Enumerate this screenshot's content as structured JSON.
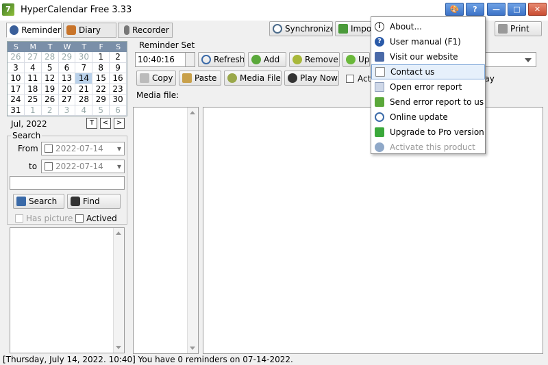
{
  "window": {
    "title": "HyperCalendar Free 3.33",
    "app_icon": "7"
  },
  "titlebar_buttons": {
    "theme": "🎨",
    "help": "?",
    "minimize": "—",
    "maximize": "□",
    "close": "✕"
  },
  "tabs": [
    {
      "label": "Reminder",
      "active": true
    },
    {
      "label": "Diary",
      "active": false
    },
    {
      "label": "Recorder",
      "active": false
    }
  ],
  "toolbar": {
    "synchronize": "Synchronize",
    "import": "Impo",
    "print": "Print"
  },
  "calendar": {
    "weekdays": [
      "S",
      "M",
      "T",
      "W",
      "T",
      "F",
      "S"
    ],
    "days": [
      {
        "d": "26",
        "o": true
      },
      {
        "d": "27",
        "o": true
      },
      {
        "d": "28",
        "o": true
      },
      {
        "d": "29",
        "o": true
      },
      {
        "d": "30",
        "o": true
      },
      {
        "d": "1",
        "o": false
      },
      {
        "d": "2",
        "o": false
      },
      {
        "d": "3",
        "o": false
      },
      {
        "d": "4",
        "o": false
      },
      {
        "d": "5",
        "o": false
      },
      {
        "d": "6",
        "o": false
      },
      {
        "d": "7",
        "o": false
      },
      {
        "d": "8",
        "o": false
      },
      {
        "d": "9",
        "o": false
      },
      {
        "d": "10",
        "o": false
      },
      {
        "d": "11",
        "o": false
      },
      {
        "d": "12",
        "o": false
      },
      {
        "d": "13",
        "o": false
      },
      {
        "d": "14",
        "o": false,
        "t": true
      },
      {
        "d": "15",
        "o": false
      },
      {
        "d": "16",
        "o": false
      },
      {
        "d": "17",
        "o": false
      },
      {
        "d": "18",
        "o": false
      },
      {
        "d": "19",
        "o": false
      },
      {
        "d": "20",
        "o": false
      },
      {
        "d": "21",
        "o": false
      },
      {
        "d": "22",
        "o": false
      },
      {
        "d": "23",
        "o": false
      },
      {
        "d": "24",
        "o": false
      },
      {
        "d": "25",
        "o": false
      },
      {
        "d": "26",
        "o": false
      },
      {
        "d": "27",
        "o": false
      },
      {
        "d": "28",
        "o": false
      },
      {
        "d": "29",
        "o": false
      },
      {
        "d": "30",
        "o": false
      },
      {
        "d": "31",
        "o": false
      },
      {
        "d": "1",
        "o": true
      },
      {
        "d": "2",
        "o": true
      },
      {
        "d": "3",
        "o": true
      },
      {
        "d": "4",
        "o": true
      },
      {
        "d": "5",
        "o": true
      },
      {
        "d": "6",
        "o": true
      }
    ],
    "month_label": "Jul, 2022",
    "nav_today": "T",
    "nav_prev": "<",
    "nav_next": ">"
  },
  "search": {
    "group_label": "Search",
    "from_label": "From",
    "from_value": "2022-07-14",
    "to_label": "to",
    "to_value": "2022-07-14",
    "text_value": "",
    "search_button": "Search",
    "find_button": "Find",
    "has_picture_label": "Has picture",
    "actived_label": "Actived"
  },
  "reminder_set": {
    "group_label": "Reminder Set",
    "time_value": "10:40:16",
    "refresh": "Refresh",
    "add": "Add",
    "remove": "Remove",
    "update": "Up",
    "copy": "Copy",
    "paste": "Paste",
    "media_file_button": "Media File",
    "play_now": "Play Now",
    "active_label": "Act",
    "play_label": "lay",
    "media_file_label": "Media file:"
  },
  "menu": {
    "items": [
      {
        "label": "About...",
        "icon": "info-icon",
        "disabled": false,
        "highlight": false
      },
      {
        "label": "User manual (F1)",
        "icon": "help-icon",
        "disabled": false,
        "highlight": false
      },
      {
        "label": "Visit our website",
        "icon": "home-icon",
        "disabled": false,
        "highlight": false
      },
      {
        "label": "Contact us",
        "icon": "mail-icon",
        "disabled": false,
        "highlight": true
      },
      {
        "label": "Open error report",
        "icon": "document-icon",
        "disabled": false,
        "highlight": false
      },
      {
        "label": "Send error report to us",
        "icon": "send-icon",
        "disabled": false,
        "highlight": false
      },
      {
        "label": "Online update",
        "icon": "update-icon",
        "disabled": false,
        "highlight": false
      },
      {
        "label": "Upgrade to Pro version",
        "icon": "upgrade-icon",
        "disabled": false,
        "highlight": false
      },
      {
        "label": "Activate this product",
        "icon": "activate-icon",
        "disabled": true,
        "highlight": false
      }
    ]
  },
  "status": {
    "text": "[Thursday, July 14, 2022. 10:40] You have 0 reminders on 07-14-2022."
  },
  "colors": {
    "accent": "#3d73c7",
    "highlight": "#e6f0fb",
    "calendar_header": "#7a8fa8",
    "today": "#b9d1ea"
  }
}
